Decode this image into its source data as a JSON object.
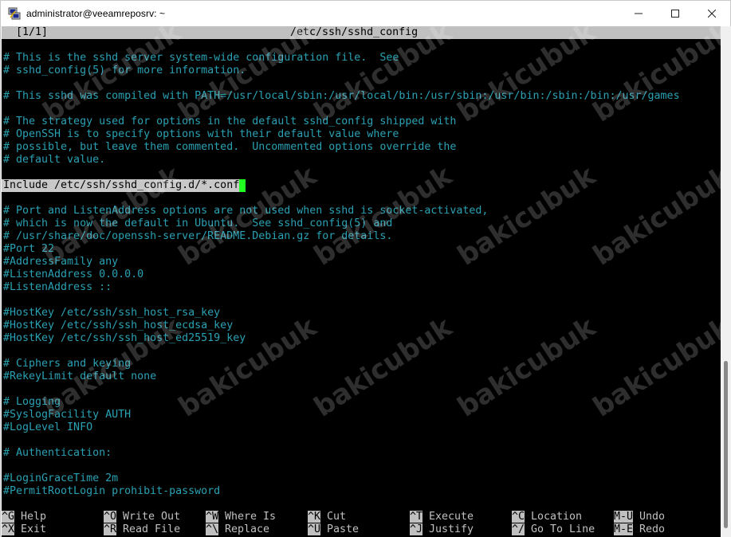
{
  "window": {
    "title": "administrator@veeamreposrv: ~",
    "minimize_glyph": "—",
    "maximize_glyph": "☐",
    "close_glyph": "✕",
    "icon": "putty-icon"
  },
  "editor": {
    "position": "[1/1]",
    "filename": "/etc/ssh/sshd_config",
    "lines": [
      {
        "text": "# This is the sshd server system-wide configuration file.  See",
        "kind": "comment"
      },
      {
        "text": "# sshd_config(5) for more information.",
        "kind": "comment"
      },
      {
        "text": "",
        "kind": "blank"
      },
      {
        "text": "# This sshd was compiled with PATH=/usr/local/sbin:/usr/local/bin:/usr/sbin:/usr/bin:/sbin:/bin:/usr/games",
        "kind": "comment"
      },
      {
        "text": "",
        "kind": "blank"
      },
      {
        "text": "# The strategy used for options in the default sshd_config shipped with",
        "kind": "comment"
      },
      {
        "text": "# OpenSSH is to specify options with their default value where",
        "kind": "comment"
      },
      {
        "text": "# possible, but leave them commented.  Uncommented options override the",
        "kind": "comment"
      },
      {
        "text": "# default value.",
        "kind": "comment"
      },
      {
        "text": "",
        "kind": "blank"
      },
      {
        "text": "Include /etc/ssh/sshd_config.d/*.conf",
        "kind": "include"
      },
      {
        "text": "",
        "kind": "blank"
      },
      {
        "text": "# Port and ListenAddress options are not used when sshd is socket-activated,",
        "kind": "comment"
      },
      {
        "text": "# which is now the default in Ubuntu.  See sshd_config(5) and",
        "kind": "comment"
      },
      {
        "text": "# /usr/share/doc/openssh-server/README.Debian.gz for details.",
        "kind": "comment"
      },
      {
        "text": "#Port 22",
        "kind": "comment"
      },
      {
        "text": "#AddressFamily any",
        "kind": "comment"
      },
      {
        "text": "#ListenAddress 0.0.0.0",
        "kind": "comment"
      },
      {
        "text": "#ListenAddress ::",
        "kind": "comment"
      },
      {
        "text": "",
        "kind": "blank"
      },
      {
        "text": "#HostKey /etc/ssh/ssh_host_rsa_key",
        "kind": "comment"
      },
      {
        "text": "#HostKey /etc/ssh/ssh_host_ecdsa_key",
        "kind": "comment"
      },
      {
        "text": "#HostKey /etc/ssh/ssh_host_ed25519_key",
        "kind": "comment"
      },
      {
        "text": "",
        "kind": "blank"
      },
      {
        "text": "# Ciphers and keying",
        "kind": "comment"
      },
      {
        "text": "#RekeyLimit default none",
        "kind": "comment"
      },
      {
        "text": "",
        "kind": "blank"
      },
      {
        "text": "# Logging",
        "kind": "comment"
      },
      {
        "text": "#SyslogFacility AUTH",
        "kind": "comment"
      },
      {
        "text": "#LogLevel INFO",
        "kind": "comment"
      },
      {
        "text": "",
        "kind": "blank"
      },
      {
        "text": "# Authentication:",
        "kind": "comment"
      },
      {
        "text": "",
        "kind": "blank"
      },
      {
        "text": "#LoginGraceTime 2m",
        "kind": "comment"
      },
      {
        "text": "#PermitRootLogin prohibit-password",
        "kind": "comment"
      }
    ]
  },
  "shortcuts": [
    [
      {
        "key": "^G",
        "label": "Help"
      },
      {
        "key": "^X",
        "label": "Exit"
      }
    ],
    [
      {
        "key": "^O",
        "label": "Write Out"
      },
      {
        "key": "^R",
        "label": "Read File"
      }
    ],
    [
      {
        "key": "^W",
        "label": "Where Is"
      },
      {
        "key": "^\\",
        "label": "Replace"
      }
    ],
    [
      {
        "key": "^K",
        "label": "Cut"
      },
      {
        "key": "^U",
        "label": "Paste"
      }
    ],
    [
      {
        "key": "^T",
        "label": "Execute"
      },
      {
        "key": "^J",
        "label": "Justify"
      }
    ],
    [
      {
        "key": "^C",
        "label": "Location"
      },
      {
        "key": "^/",
        "label": "Go To Line"
      }
    ],
    [
      {
        "key": "M-U",
        "label": "Undo"
      },
      {
        "key": "M-E",
        "label": "Redo"
      }
    ]
  ],
  "watermark": "bakicubuk",
  "colors": {
    "comment": "#2aa1b3",
    "background": "#000000",
    "cursor": "#21ff21"
  }
}
